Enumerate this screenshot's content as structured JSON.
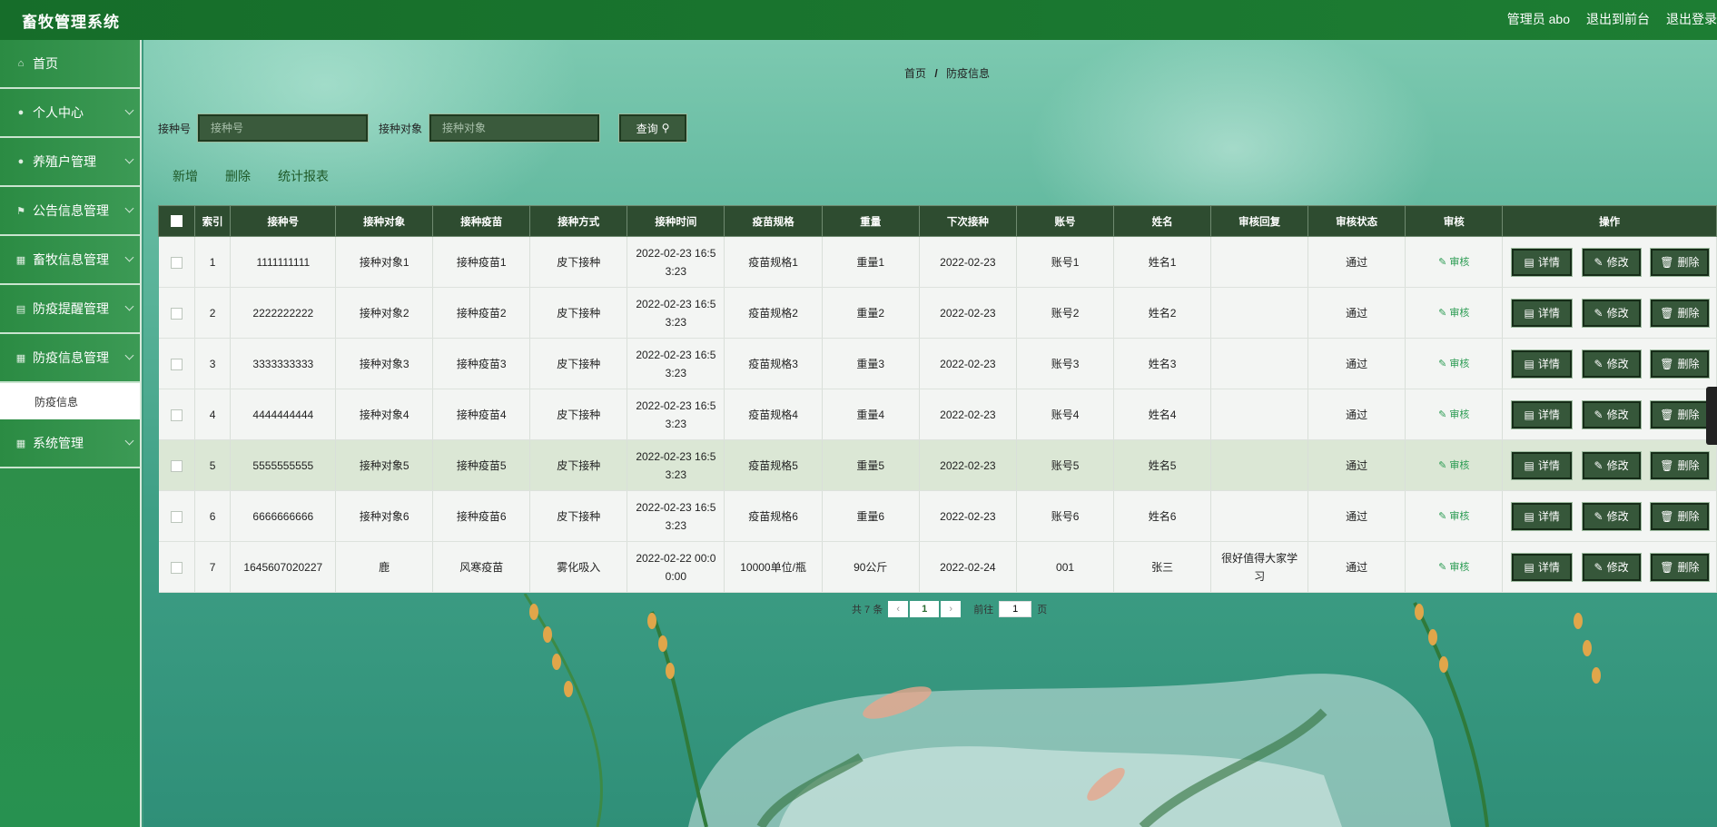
{
  "topbar": {
    "title": "畜牧管理系统",
    "admin": "管理员 abo",
    "front": "退出到前台",
    "logout": "退出登录"
  },
  "sidebar": {
    "items": [
      {
        "label": "首页",
        "icon": "home-icon"
      },
      {
        "label": "个人中心",
        "icon": "user-icon"
      },
      {
        "label": "养殖户管理",
        "icon": "user-icon"
      },
      {
        "label": "公告信息管理",
        "icon": "flag-icon"
      },
      {
        "label": "畜牧信息管理",
        "icon": "grid-icon"
      },
      {
        "label": "防疫提醒管理",
        "icon": "doc-icon"
      },
      {
        "label": "防疫信息管理",
        "icon": "grid-icon"
      }
    ],
    "sub_item": "防疫信息",
    "last_item": {
      "label": "系统管理",
      "icon": "grid-icon"
    }
  },
  "breadcrumb": {
    "home": "首页",
    "sep": "/",
    "current": "防疫信息"
  },
  "search": {
    "label1": "接种号",
    "placeholder1": "接种号",
    "label2": "接种对象",
    "placeholder2": "接种对象",
    "button": "查询"
  },
  "actions": {
    "add": "新增",
    "delete": "删除",
    "report": "统计报表"
  },
  "table": {
    "headers": [
      "索引",
      "接种号",
      "接种对象",
      "接种疫苗",
      "接种方式",
      "接种时间",
      "疫苗规格",
      "重量",
      "下次接种",
      "账号",
      "姓名",
      "审核回复",
      "审核状态",
      "审核",
      "操作"
    ],
    "audit_label": "审核",
    "btn_detail": "详情",
    "btn_edit": "修改",
    "btn_delete": "删除",
    "rows": [
      {
        "idx": "1",
        "no": "1111111111",
        "target": "接种对象1",
        "vaccine": "接种疫苗1",
        "method": "皮下接种",
        "time": "2022-02-23 16:5\n3:23",
        "spec": "疫苗规格1",
        "weight": "重量1",
        "next": "2022-02-23",
        "account": "账号1",
        "name": "姓名1",
        "reply": "",
        "status": "通过"
      },
      {
        "idx": "2",
        "no": "2222222222",
        "target": "接种对象2",
        "vaccine": "接种疫苗2",
        "method": "皮下接种",
        "time": "2022-02-23 16:5\n3:23",
        "spec": "疫苗规格2",
        "weight": "重量2",
        "next": "2022-02-23",
        "account": "账号2",
        "name": "姓名2",
        "reply": "",
        "status": "通过"
      },
      {
        "idx": "3",
        "no": "3333333333",
        "target": "接种对象3",
        "vaccine": "接种疫苗3",
        "method": "皮下接种",
        "time": "2022-02-23 16:5\n3:23",
        "spec": "疫苗规格3",
        "weight": "重量3",
        "next": "2022-02-23",
        "account": "账号3",
        "name": "姓名3",
        "reply": "",
        "status": "通过"
      },
      {
        "idx": "4",
        "no": "4444444444",
        "target": "接种对象4",
        "vaccine": "接种疫苗4",
        "method": "皮下接种",
        "time": "2022-02-23 16:5\n3:23",
        "spec": "疫苗规格4",
        "weight": "重量4",
        "next": "2022-02-23",
        "account": "账号4",
        "name": "姓名4",
        "reply": "",
        "status": "通过"
      },
      {
        "idx": "5",
        "no": "5555555555",
        "target": "接种对象5",
        "vaccine": "接种疫苗5",
        "method": "皮下接种",
        "time": "2022-02-23 16:5\n3:23",
        "spec": "疫苗规格5",
        "weight": "重量5",
        "next": "2022-02-23",
        "account": "账号5",
        "name": "姓名5",
        "reply": "",
        "status": "通过"
      },
      {
        "idx": "6",
        "no": "6666666666",
        "target": "接种对象6",
        "vaccine": "接种疫苗6",
        "method": "皮下接种",
        "time": "2022-02-23 16:5\n3:23",
        "spec": "疫苗规格6",
        "weight": "重量6",
        "next": "2022-02-23",
        "account": "账号6",
        "name": "姓名6",
        "reply": "",
        "status": "通过"
      },
      {
        "idx": "7",
        "no": "1645607020227",
        "target": "鹿",
        "vaccine": "风寒疫苗",
        "method": "雾化吸入",
        "time": "2022-02-22 00:0\n0:00",
        "spec": "10000单位/瓶",
        "weight": "90公斤",
        "next": "2022-02-24",
        "account": "001",
        "name": "张三",
        "reply": "很好值得大家学\n习",
        "status": "通过"
      }
    ]
  },
  "pager": {
    "total": "共 7 条",
    "page": "1",
    "goto_label": "前往",
    "goto_value": "1",
    "page_unit": "页"
  }
}
